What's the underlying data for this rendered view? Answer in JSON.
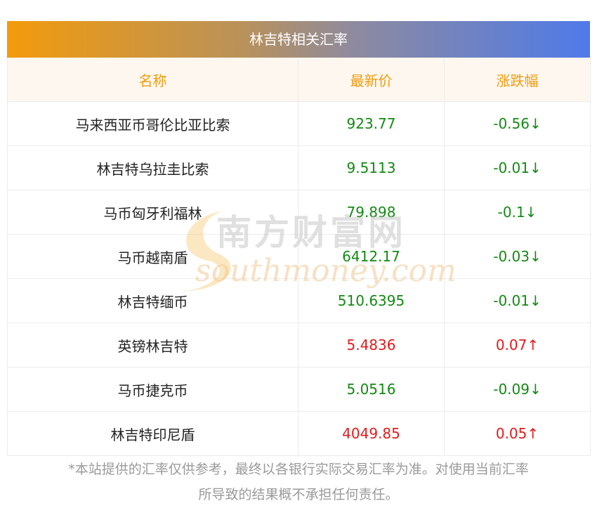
{
  "title": "林吉特相关汇率",
  "headers": [
    "名称",
    "最新价",
    "涨跌幅"
  ],
  "rows": [
    {
      "name": "马来西亚币哥伦比亚比索",
      "price": "923.77",
      "change": "-0.56↓",
      "dir": "down"
    },
    {
      "name": "林吉特乌拉圭比索",
      "price": "9.5113",
      "change": "-0.01↓",
      "dir": "down"
    },
    {
      "name": "马币匈牙利福林",
      "price": "79.898",
      "change": "-0.1↓",
      "dir": "down"
    },
    {
      "name": "马币越南盾",
      "price": "6412.17",
      "change": "-0.03↓",
      "dir": "down"
    },
    {
      "name": "林吉特缅币",
      "price": "510.6395",
      "change": "-0.01↓",
      "dir": "down"
    },
    {
      "name": "英镑林吉特",
      "price": "5.4836",
      "change": "0.07↑",
      "dir": "up"
    },
    {
      "name": "马币捷克币",
      "price": "5.0516",
      "change": "-0.09↓",
      "dir": "down"
    },
    {
      "name": "林吉特印尼盾",
      "price": "4049.85",
      "change": "0.05↑",
      "dir": "up"
    }
  ],
  "watermark": {
    "cn": "南方财富网",
    "en": "southmoney.com"
  },
  "footer": {
    "line1": "*本站提供的汇率仅供参考，最终以各银行实际交易汇率为准。对使用当前汇率",
    "line2": "所导致的结果概不承担任何责任。"
  },
  "colors": {
    "accent_orange": "#f39b0c",
    "accent_blue": "#4f7ae8",
    "down": "#138a13",
    "up": "#e41a1a"
  }
}
